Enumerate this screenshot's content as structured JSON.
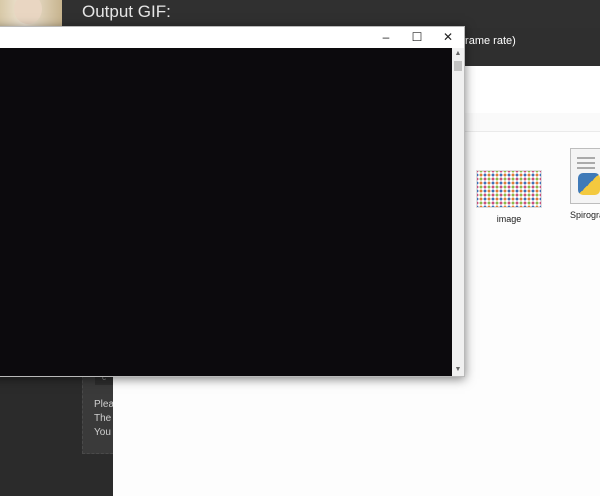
{
  "page": {
    "output_title": "Output GIF:",
    "frame_rate_text": "frame rate)"
  },
  "side_panel": {
    "button_label": "c",
    "lines": [
      "Plea",
      "The",
      "You"
    ]
  },
  "explorer": {
    "files": [
      {
        "name": "image",
        "icon": "image-thumbnail-icon"
      },
      {
        "name": "Spirogra",
        "icon": "python-file-icon"
      }
    ]
  },
  "window": {
    "controls": {
      "minimize": "–",
      "maximize": "☐",
      "close": "✕"
    },
    "scroll_up": "▲",
    "scroll_down": "▼",
    "canvas_color": "#0c0a0d"
  }
}
